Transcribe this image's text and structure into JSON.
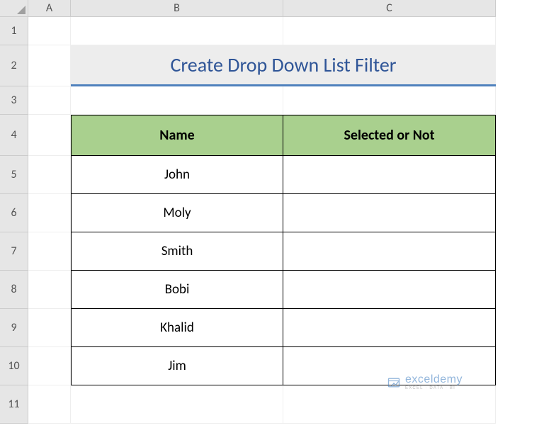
{
  "columns": [
    "A",
    "B",
    "C"
  ],
  "rows": [
    "1",
    "2",
    "3",
    "4",
    "5",
    "6",
    "7",
    "8",
    "9",
    "10",
    "11"
  ],
  "title": "Create Drop Down List Filter",
  "table": {
    "headers": {
      "name": "Name",
      "selected": "Selected or Not"
    },
    "rows": [
      {
        "name": "John",
        "selected": ""
      },
      {
        "name": "Moly",
        "selected": ""
      },
      {
        "name": "Smith",
        "selected": ""
      },
      {
        "name": "Bobi",
        "selected": ""
      },
      {
        "name": "Khalid",
        "selected": ""
      },
      {
        "name": "Jim",
        "selected": ""
      }
    ]
  },
  "watermark": {
    "brand": "exceldemy",
    "tagline": "EXCEL · DATA · BI"
  }
}
